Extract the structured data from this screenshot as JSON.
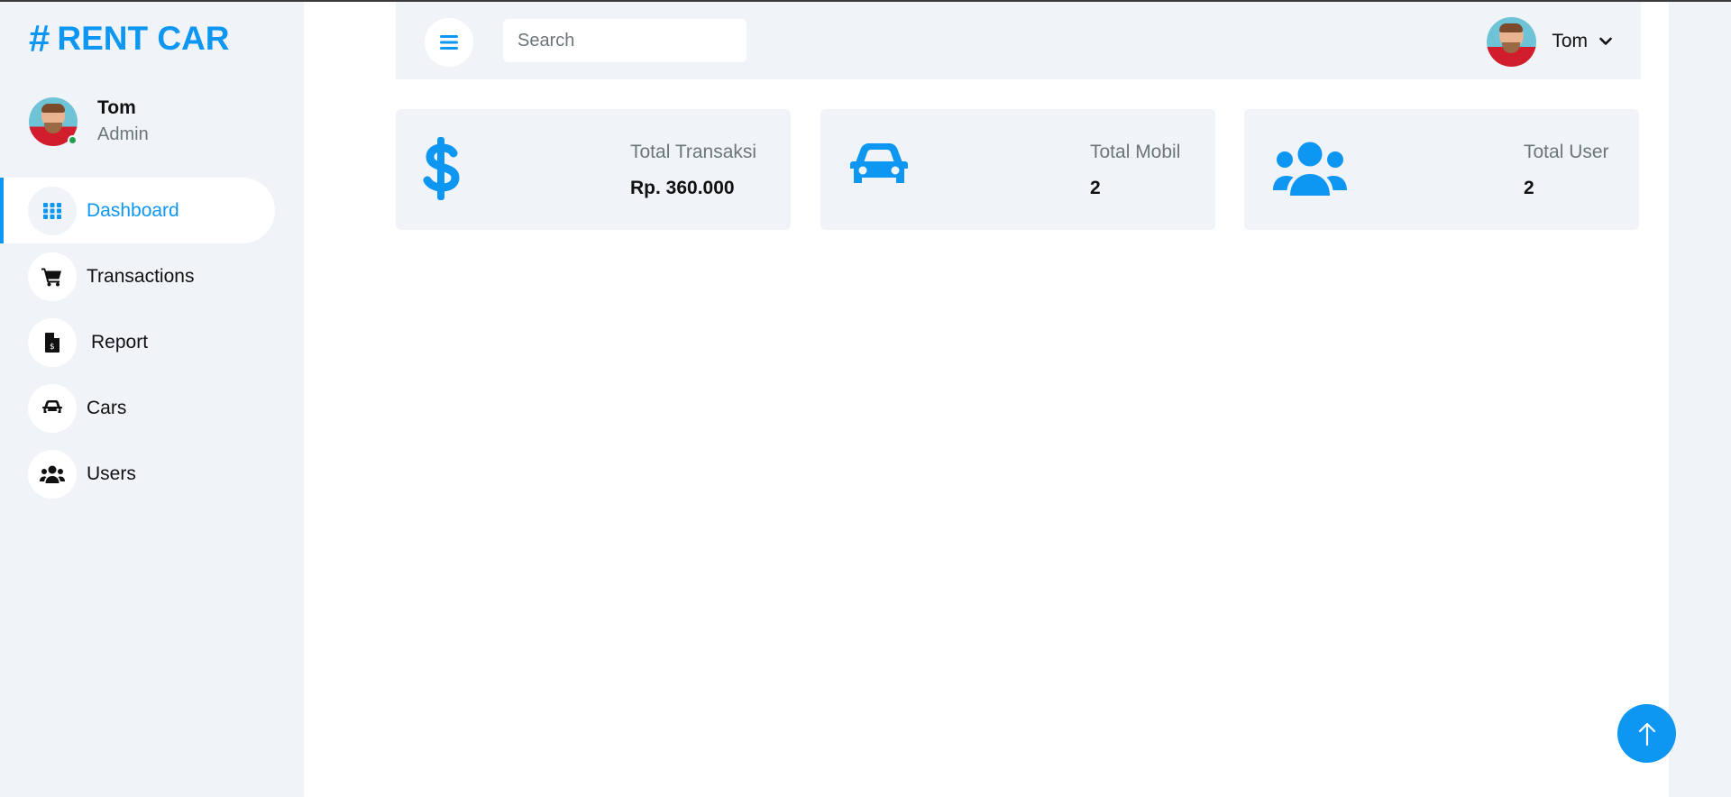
{
  "brand": {
    "hash": "#",
    "name": "RENT CAR",
    "color": "#0d96f2"
  },
  "profile": {
    "name": "Tom",
    "role": "Admin",
    "status": "online"
  },
  "sidebar": {
    "items": [
      {
        "label": "Dashboard",
        "icon": "grid-icon",
        "active": true
      },
      {
        "label": "Transactions",
        "icon": "cart-icon",
        "active": false
      },
      {
        "label": "Report",
        "icon": "file-invoice-icon",
        "active": false
      },
      {
        "label": "Cars",
        "icon": "car-icon",
        "active": false
      },
      {
        "label": "Users",
        "icon": "users-icon",
        "active": false
      }
    ]
  },
  "topbar": {
    "search": {
      "placeholder": "Search",
      "value": ""
    },
    "user": {
      "name": "Tom"
    }
  },
  "cards": [
    {
      "label": "Total Transaksi",
      "value": "Rp. 360.000",
      "icon": "dollar-icon"
    },
    {
      "label": "Total Mobil",
      "value": "2",
      "icon": "car-icon"
    },
    {
      "label": "Total User",
      "value": "2",
      "icon": "users-icon"
    }
  ],
  "colors": {
    "accent": "#0d96f2",
    "panel": "#f0f4f8"
  }
}
